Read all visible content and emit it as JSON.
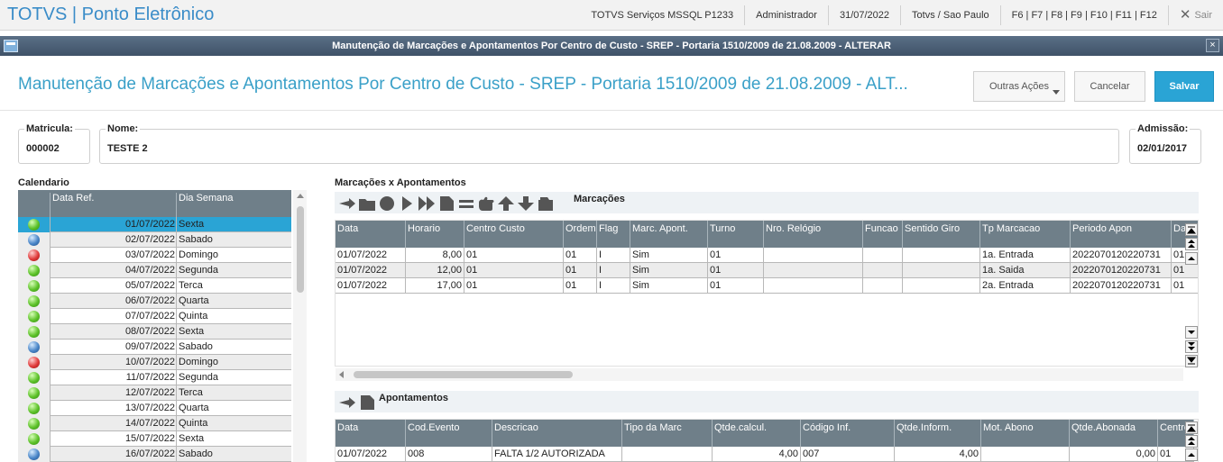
{
  "app": {
    "title": "TOTVS | Ponto Eletrônico",
    "server": "TOTVS Serviços MSSQL P1233",
    "user": "Administrador",
    "date": "31/07/2022",
    "location": "Totvs / Sao Paulo",
    "shortcuts": "F6 | F7 | F8 | F9 | F10 | F11 | F12",
    "exit_label": "Sair"
  },
  "window": {
    "title": "Manutenção de Marcações e Apontamentos Por Centro de Custo - SREP - Portaria 1510/2009 de 21.08.2009 - ALTERAR",
    "close_glyph": "×"
  },
  "header": {
    "title": "Manutenção de Marcações e Apontamentos Por Centro de Custo - SREP - Portaria 1510/2009 de 21.08.2009 - ALT...",
    "outras_label": "Outras Ações",
    "cancelar_label": "Cancelar",
    "salvar_label": "Salvar"
  },
  "fields": {
    "matricula": {
      "label": "Matricula:",
      "value": "000002"
    },
    "nome": {
      "label": "Nome:",
      "value": "TESTE 2"
    },
    "admissao": {
      "label": "Admissão:",
      "value": "02/01/2017"
    }
  },
  "calendar": {
    "section_label": "Calendario",
    "columns": [
      "Data Ref.",
      "Dia Semana"
    ],
    "rows": [
      {
        "status": "green",
        "date": "01/07/2022",
        "day": "Sexta",
        "selected": true
      },
      {
        "status": "blue",
        "date": "02/07/2022",
        "day": "Sabado"
      },
      {
        "status": "red",
        "date": "03/07/2022",
        "day": "Domingo"
      },
      {
        "status": "green",
        "date": "04/07/2022",
        "day": "Segunda"
      },
      {
        "status": "green",
        "date": "05/07/2022",
        "day": "Terca"
      },
      {
        "status": "green",
        "date": "06/07/2022",
        "day": "Quarta"
      },
      {
        "status": "green",
        "date": "07/07/2022",
        "day": "Quinta"
      },
      {
        "status": "green",
        "date": "08/07/2022",
        "day": "Sexta"
      },
      {
        "status": "blue",
        "date": "09/07/2022",
        "day": "Sabado"
      },
      {
        "status": "red",
        "date": "10/07/2022",
        "day": "Domingo"
      },
      {
        "status": "green",
        "date": "11/07/2022",
        "day": "Segunda"
      },
      {
        "status": "green",
        "date": "12/07/2022",
        "day": "Terca"
      },
      {
        "status": "green",
        "date": "13/07/2022",
        "day": "Quarta"
      },
      {
        "status": "green",
        "date": "14/07/2022",
        "day": "Quinta"
      },
      {
        "status": "green",
        "date": "15/07/2022",
        "day": "Sexta"
      },
      {
        "status": "blue",
        "date": "16/07/2022",
        "day": "Sabado"
      }
    ]
  },
  "marcacoes": {
    "section_label": "Marcações x Apontamentos",
    "toolbar_label": "Marcações",
    "columns": [
      "Data",
      "Horario",
      "Centro Custo",
      "Ordem",
      "Flag",
      "Marc. Apont.",
      "Turno",
      "Nro. Relógio",
      "Funcao",
      "Sentido Giro",
      "Tp Marcacao",
      "Periodo Apon",
      "Da"
    ],
    "rows": [
      [
        "01/07/2022",
        "8,00",
        "01",
        "01",
        "I",
        "Sim",
        "01",
        "",
        "",
        "",
        "1a. Entrada",
        "2022070120220731",
        "01"
      ],
      [
        "01/07/2022",
        "12,00",
        "01",
        "01",
        "I",
        "Sim",
        "01",
        "",
        "",
        "",
        "1a. Saida",
        "2022070120220731",
        "01"
      ],
      [
        "01/07/2022",
        "17,00",
        "01",
        "01",
        "I",
        "Sim",
        "01",
        "",
        "",
        "",
        "2a. Entrada",
        "2022070120220731",
        "01"
      ]
    ]
  },
  "apontamentos": {
    "toolbar_label": "Apontamentos",
    "columns": [
      "Data",
      "Cod.Evento",
      "Descricao",
      "Tipo da Marc",
      "Qtde.calcul.",
      "Código Inf.",
      "Qtde.Inform.",
      "Mot. Abono",
      "Qtde.Abonada",
      "Centro"
    ],
    "rows": [
      [
        "01/07/2022",
        "008",
        "FALTA 1/2 AUTORIZADA",
        "",
        "4,00",
        "007",
        "4,00",
        "",
        "0,00",
        "01"
      ]
    ]
  }
}
